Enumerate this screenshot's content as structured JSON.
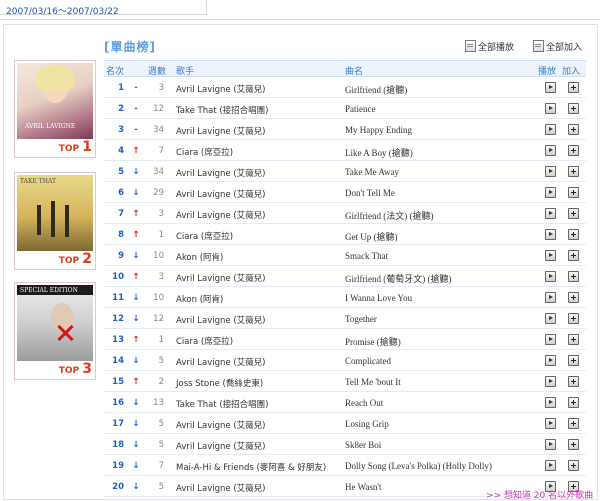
{
  "header": {
    "date_range": "2007/03/16～2007/03/22"
  },
  "section": {
    "title": "[單曲榜]"
  },
  "actions": {
    "play_all": "全部播放",
    "add_all": "全部加入"
  },
  "albums": [
    {
      "label_prefix": "TOP",
      "label_num": "1",
      "cover_text": "AVRIL LAVIGNE"
    },
    {
      "label_prefix": "TOP",
      "label_num": "2",
      "cover_text": "TAKE THAT"
    },
    {
      "label_prefix": "TOP",
      "label_num": "3",
      "cover_text": "SPECIAL EDITION"
    }
  ],
  "table": {
    "columns": {
      "rank": "名次",
      "weeks": "週數",
      "artist": "歌手",
      "song": "曲名",
      "play": "播放",
      "add": "加入"
    },
    "rows": [
      {
        "rank": "1",
        "trend": "same",
        "trend_symbol": "-",
        "weeks": "3",
        "artist": "Avril Lavigne (艾薇兒)",
        "song": "Girlfriend (搶聽)"
      },
      {
        "rank": "2",
        "trend": "same",
        "trend_symbol": "-",
        "weeks": "12",
        "artist": "Take That (接招合唱團)",
        "song": "Patience"
      },
      {
        "rank": "3",
        "trend": "same",
        "trend_symbol": "-",
        "weeks": "34",
        "artist": "Avril Lavigne (艾薇兒)",
        "song": "My Happy Ending"
      },
      {
        "rank": "4",
        "trend": "up",
        "trend_symbol": "↑",
        "weeks": "7",
        "artist": "Ciara (席亞拉)",
        "song": "Like A Boy (搶聽)"
      },
      {
        "rank": "5",
        "trend": "down",
        "trend_symbol": "↓",
        "weeks": "34",
        "artist": "Avril Lavigne (艾薇兒)",
        "song": "Take Me Away"
      },
      {
        "rank": "6",
        "trend": "down",
        "trend_symbol": "↓",
        "weeks": "29",
        "artist": "Avril Lavigne (艾薇兒)",
        "song": "Don't Tell Me"
      },
      {
        "rank": "7",
        "trend": "up",
        "trend_symbol": "↑",
        "weeks": "3",
        "artist": "Avril Lavigne (艾薇兒)",
        "song": "Girlfriend (法文) (搶聽)"
      },
      {
        "rank": "8",
        "trend": "up",
        "trend_symbol": "↑",
        "weeks": "1",
        "artist": "Ciara (席亞拉)",
        "song": "Get Up (搶聽)"
      },
      {
        "rank": "9",
        "trend": "down",
        "trend_symbol": "↓",
        "weeks": "10",
        "artist": "Akon (阿肯)",
        "song": "Smack That"
      },
      {
        "rank": "10",
        "trend": "up",
        "trend_symbol": "↑",
        "weeks": "3",
        "artist": "Avril Lavigne (艾薇兒)",
        "song": "Girlfriend (葡萄牙文) (搶聽)"
      },
      {
        "rank": "11",
        "trend": "down",
        "trend_symbol": "↓",
        "weeks": "10",
        "artist": "Akon (阿肯)",
        "song": "I Wanna Love You"
      },
      {
        "rank": "12",
        "trend": "down",
        "trend_symbol": "↓",
        "weeks": "12",
        "artist": "Avril Lavigne (艾薇兒)",
        "song": "Together"
      },
      {
        "rank": "13",
        "trend": "up",
        "trend_symbol": "↑",
        "weeks": "1",
        "artist": "Ciara (席亞拉)",
        "song": "Promise (搶聽)"
      },
      {
        "rank": "14",
        "trend": "down",
        "trend_symbol": "↓",
        "weeks": "5",
        "artist": "Avril Lavigne (艾薇兒)",
        "song": "Complicated"
      },
      {
        "rank": "15",
        "trend": "up",
        "trend_symbol": "↑",
        "weeks": "2",
        "artist": "Joss Stone (喬絲史東)",
        "song": "Tell Me 'bout It"
      },
      {
        "rank": "16",
        "trend": "down",
        "trend_symbol": "↓",
        "weeks": "13",
        "artist": "Take That (接招合唱團)",
        "song": "Reach Out"
      },
      {
        "rank": "17",
        "trend": "down",
        "trend_symbol": "↓",
        "weeks": "5",
        "artist": "Avril Lavigne (艾薇兒)",
        "song": "Losing Grip"
      },
      {
        "rank": "18",
        "trend": "down",
        "trend_symbol": "↓",
        "weeks": "5",
        "artist": "Avril Lavigne (艾薇兒)",
        "song": "Sk8er Boi"
      },
      {
        "rank": "19",
        "trend": "down",
        "trend_symbol": "↓",
        "weeks": "7",
        "artist": "Mai-A-Hi & Friends (麥阿喜 & 好朋友)",
        "song": "Dolly Song (Leva's Polka) (Holly Dolly)"
      },
      {
        "rank": "20",
        "trend": "down",
        "trend_symbol": "↓",
        "weeks": "5",
        "artist": "Avril Lavigne (艾薇兒)",
        "song": "He Wasn't"
      }
    ]
  },
  "footer": {
    "more_link": ">> 想知道 20 名以外歌曲"
  },
  "colors": {
    "accent_blue": "#3a7bcc",
    "up_red": "#e21b1b",
    "down_blue": "#1e5bd6",
    "top_label": "#e23b1e",
    "more_link": "#d52fb5"
  }
}
